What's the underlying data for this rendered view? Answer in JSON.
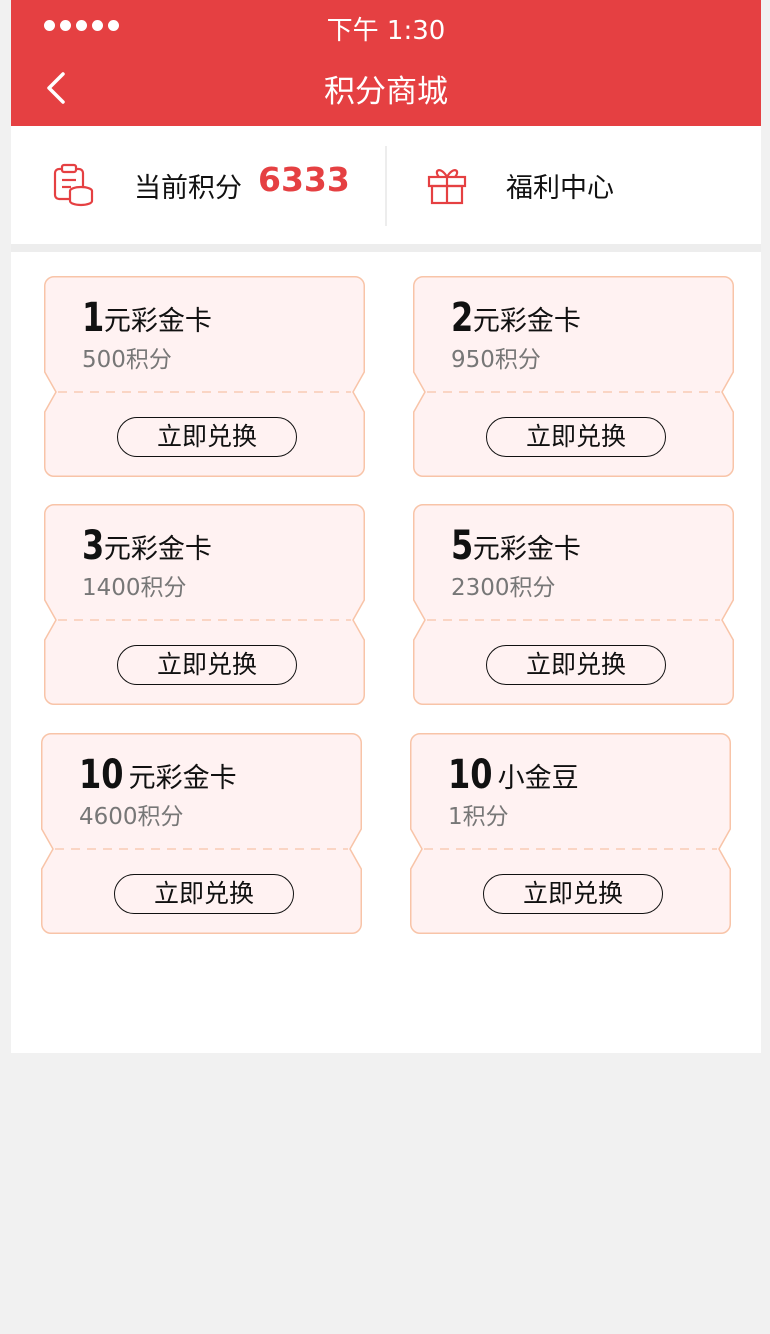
{
  "status": {
    "time": "下午 1:30"
  },
  "nav": {
    "title": "积分商城"
  },
  "header": {
    "points_label": "当前积分",
    "points_value": "6333",
    "welfare_label": "福利中心"
  },
  "colors": {
    "accent": "#e54042",
    "text": "#111111",
    "muted": "#777777",
    "divider": "#ededed",
    "background": "#f1f1f1",
    "card_fill": "#fff2f2",
    "card_border": "#f8c4a8"
  },
  "cards": [
    {
      "amount": "1",
      "unit": "元彩金卡",
      "price": "500积分",
      "button": "立即兑换"
    },
    {
      "amount": "2",
      "unit": "元彩金卡",
      "price": "950积分",
      "button": "立即兑换"
    },
    {
      "amount": "3",
      "unit": "元彩金卡",
      "price": "1400积分",
      "button": "立即兑换"
    },
    {
      "amount": "5",
      "unit": "元彩金卡",
      "price": "2300积分",
      "button": "立即兑换"
    },
    {
      "amount": "10",
      "unit": "元彩金卡",
      "price": "4600积分",
      "button": "立即兑换"
    },
    {
      "amount": "10",
      "unit": "小金豆",
      "price": "1积分",
      "button": "立即兑换"
    }
  ]
}
